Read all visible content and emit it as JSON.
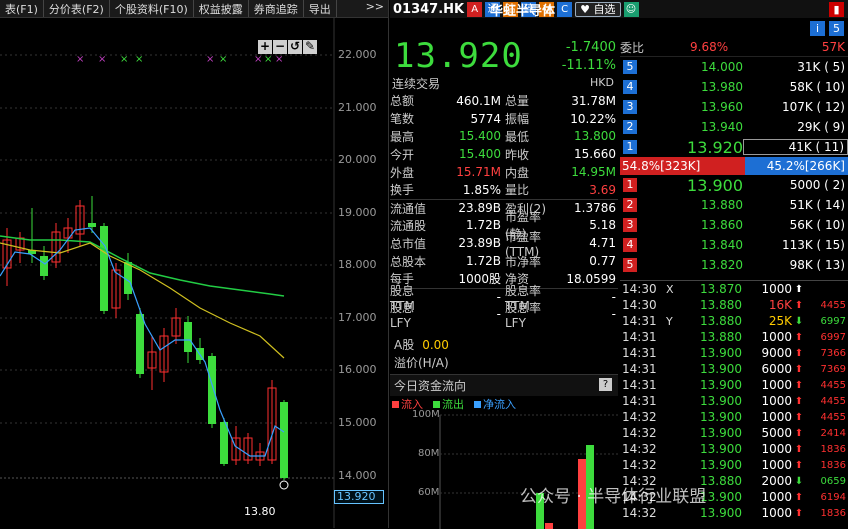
{
  "tabs": [
    "表(F1)",
    "分价表(F2)",
    "个股资料(F10)",
    "权益披露",
    "券商追踪",
    "导出"
  ],
  "tabs_more": ">>",
  "chart": {
    "yticks": [
      "22.000",
      "21.000",
      "20.000",
      "19.000",
      "18.000",
      "17.000",
      "16.000",
      "15.000",
      "14.000"
    ],
    "current_price_tag": "13.920",
    "low_label": "13.80",
    "tools": [
      "+",
      "−",
      "↺",
      "✎"
    ]
  },
  "header": {
    "code": "01347.HK",
    "name": "华虹半导体",
    "badges": [
      "A",
      "通",
      "沽",
      "碎",
      "V",
      "C"
    ],
    "watch_label": "自选",
    "right_icons": [
      "i",
      "5"
    ]
  },
  "quote": {
    "price": "13.920",
    "change": "-1.7400",
    "change_pct": "-11.11%",
    "status": "连续交易",
    "currency": "HKD"
  },
  "stats": [
    {
      "l1": "总额",
      "v1": "460.1M",
      "c1": "w",
      "l2": "总量",
      "v2": "31.78M",
      "c2": "w"
    },
    {
      "l1": "笔数",
      "v1": "5774",
      "c1": "w",
      "l2": "振幅",
      "v2": "10.22%",
      "c2": "w"
    },
    {
      "l1": "最高",
      "v1": "15.400",
      "c1": "g",
      "l2": "最低",
      "v2": "13.800",
      "c2": "g"
    },
    {
      "l1": "今开",
      "v1": "15.400",
      "c1": "g",
      "l2": "昨收",
      "v2": "15.660",
      "c2": "w"
    },
    {
      "l1": "外盘",
      "v1": "15.71M",
      "c1": "r",
      "l2": "内盘",
      "v2": "14.95M",
      "c2": "g"
    },
    {
      "l1": "换手",
      "v1": "1.85%",
      "c1": "w",
      "l2": "量比",
      "v2": "3.69",
      "c2": "r"
    },
    {
      "l1": "流通值",
      "v1": "23.89B",
      "c1": "w",
      "l2": "盈利(2)",
      "v2": "1.3786",
      "c2": "w"
    },
    {
      "l1": "流通股",
      "v1": "1.72B",
      "c1": "w",
      "l2": "市盈率(静)",
      "v2": "5.18",
      "c2": "w"
    },
    {
      "l1": "总市值",
      "v1": "23.89B",
      "c1": "w",
      "l2": "市盈率(TTM)",
      "v2": "4.71",
      "c2": "w"
    },
    {
      "l1": "总股本",
      "v1": "1.72B",
      "c1": "w",
      "l2": "市净率",
      "v2": "0.77",
      "c2": "w"
    },
    {
      "l1": "每手",
      "v1": "1000股",
      "c1": "w",
      "l2": "净资",
      "v2": "18.0599",
      "c2": "w"
    },
    {
      "l1": "股息TTM",
      "v1": "-",
      "c1": "w",
      "l2": "股息率TTM",
      "v2": "-",
      "c2": "w"
    },
    {
      "l1": "股息LFY",
      "v1": "-",
      "c1": "w",
      "l2": "股息率LFY",
      "v2": "-",
      "c2": "w"
    }
  ],
  "a_share": {
    "label": "A股",
    "value": "0.00",
    "premium_label": "溢价(H/A)"
  },
  "flow": {
    "title": "今日资金流向",
    "legend": [
      "流入",
      "流出",
      "净流入"
    ],
    "axis": [
      "100M",
      "80M",
      "60M"
    ]
  },
  "book": {
    "weibi_label": "委比",
    "weibi_pct": "9.68%",
    "weibi_vol": "57K",
    "asks": [
      {
        "n": "5",
        "price": "14.000",
        "vol": "31K ( 5)"
      },
      {
        "n": "4",
        "price": "13.980",
        "vol": "58K ( 10)"
      },
      {
        "n": "3",
        "price": "13.960",
        "vol": "107K ( 12)"
      },
      {
        "n": "2",
        "price": "13.940",
        "vol": "29K ( 9)"
      },
      {
        "n": "1",
        "price": "13.920",
        "vol": "41K ( 11)"
      }
    ],
    "ratio_bid": "54.8%[323K]",
    "ratio_ask": "45.2%[266K]",
    "bids": [
      {
        "n": "1",
        "price": "13.900",
        "vol": "5000 ( 2)"
      },
      {
        "n": "2",
        "price": "13.880",
        "vol": "51K ( 14)"
      },
      {
        "n": "3",
        "price": "13.860",
        "vol": "56K ( 10)"
      },
      {
        "n": "4",
        "price": "13.840",
        "vol": "113K ( 15)"
      },
      {
        "n": "5",
        "price": "13.820",
        "vol": "98K ( 13)"
      }
    ]
  },
  "ticks": [
    {
      "t": "14:30",
      "f": "X",
      "p": "13.870",
      "v": "1000",
      "dir": "wt",
      "n": ""
    },
    {
      "t": "14:30",
      "f": "",
      "p": "13.880",
      "v": "16K",
      "dir": "up",
      "n": "4455"
    },
    {
      "t": "14:31",
      "f": "Y",
      "p": "13.880",
      "v": "25K",
      "dir": "dn",
      "n": "6997"
    },
    {
      "t": "14:31",
      "f": "",
      "p": "13.880",
      "v": "1000",
      "dir": "up",
      "n": "6997"
    },
    {
      "t": "14:31",
      "f": "",
      "p": "13.900",
      "v": "9000",
      "dir": "up",
      "n": "7366"
    },
    {
      "t": "14:31",
      "f": "",
      "p": "13.900",
      "v": "6000",
      "dir": "up",
      "n": "7369"
    },
    {
      "t": "14:31",
      "f": "",
      "p": "13.900",
      "v": "1000",
      "dir": "up",
      "n": "4455"
    },
    {
      "t": "14:31",
      "f": "",
      "p": "13.900",
      "v": "1000",
      "dir": "up",
      "n": "4455"
    },
    {
      "t": "14:32",
      "f": "",
      "p": "13.900",
      "v": "1000",
      "dir": "up",
      "n": "4455"
    },
    {
      "t": "14:32",
      "f": "",
      "p": "13.900",
      "v": "5000",
      "dir": "up",
      "n": "2414"
    },
    {
      "t": "14:32",
      "f": "",
      "p": "13.900",
      "v": "1000",
      "dir": "up",
      "n": "1836"
    },
    {
      "t": "14:32",
      "f": "",
      "p": "13.900",
      "v": "1000",
      "dir": "up",
      "n": "1836"
    },
    {
      "t": "14:32",
      "f": "",
      "p": "13.880",
      "v": "2000",
      "dir": "dn",
      "n": "0659"
    },
    {
      "t": "14:32",
      "f": "",
      "p": "13.900",
      "v": "1000",
      "dir": "up",
      "n": "6194"
    },
    {
      "t": "14:32",
      "f": "",
      "p": "13.900",
      "v": "1000",
      "dir": "up",
      "n": "1836"
    }
  ],
  "watermark": "公众号 · 半导体行业联盟"
}
